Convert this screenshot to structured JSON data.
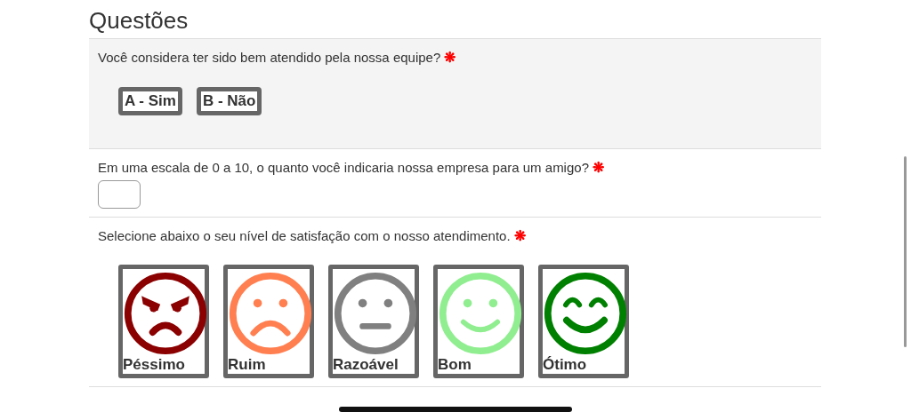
{
  "heading": "Questões",
  "questions": [
    {
      "kind": "choice",
      "text": "Você considera ter sido bem atendido pela nossa equipe?",
      "required_mark": "❋",
      "options": [
        "A - Sim",
        "B - Não"
      ]
    },
    {
      "kind": "input",
      "text": "Em uma escala de 0 a 10, o quanto você indicaria nossa empresa para um amigo?",
      "required_mark": "❋"
    },
    {
      "kind": "faces",
      "text": "Selecione abaixo o seu nível de satisfação com o nosso atendimento.",
      "required_mark": "❋",
      "faces": [
        {
          "label": "Péssimo",
          "kind": "angry",
          "color": "#8b0000"
        },
        {
          "label": "Ruim",
          "kind": "sad",
          "color": "#ff7f50"
        },
        {
          "label": "Razoável",
          "kind": "neutral",
          "color": "#808080"
        },
        {
          "label": "Bom",
          "kind": "smile",
          "color": "#90ee90"
        },
        {
          "label": "Ótimo",
          "kind": "grin",
          "color": "#008000"
        }
      ]
    }
  ]
}
